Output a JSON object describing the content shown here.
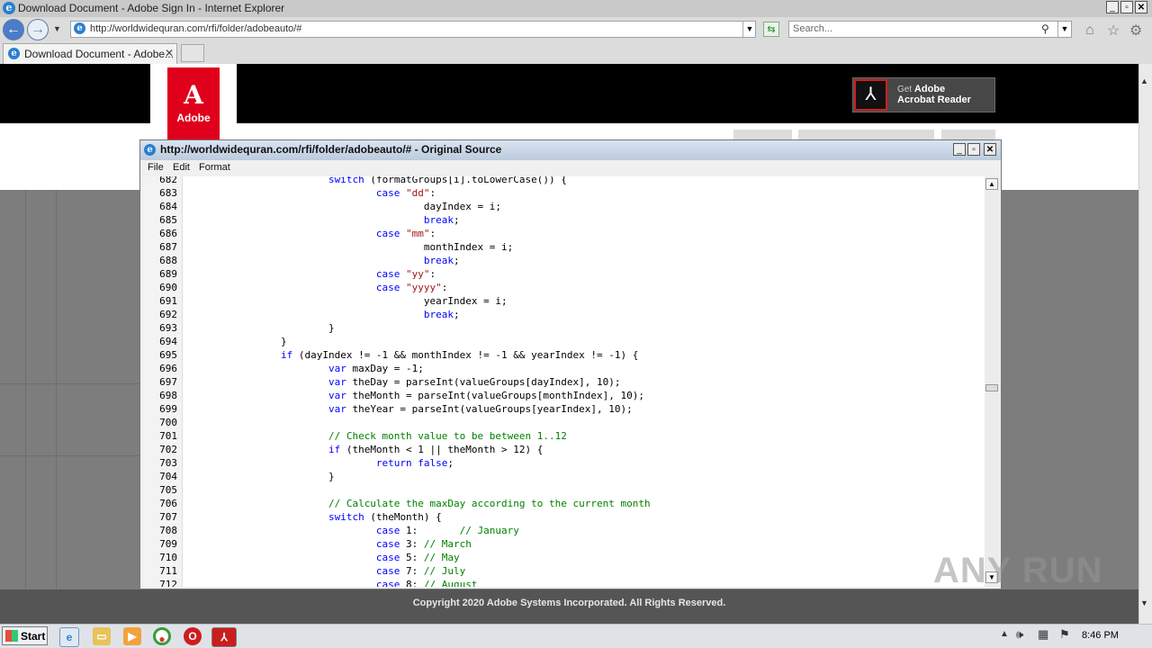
{
  "browser": {
    "window_title": "Download Document - Adobe Sign In - Internet Explorer",
    "url": "http://worldwidequran.com/rfi/folder/adobeauto/#",
    "search_placeholder": "Search...",
    "tab_label": "Download Document - Adobe..."
  },
  "page": {
    "logo_letter": "A",
    "logo_word": "Adobe",
    "reader_get": "Get",
    "reader_adobe": "Adobe",
    "reader_product": "Acrobat Reader",
    "footer": "Copyright 2020 Adobe Systems Incorporated. All Rights Reserved."
  },
  "source_window": {
    "title": "http://worldwidequran.com/rfi/folder/adobeauto/# - Original Source",
    "menu": [
      "File",
      "Edit",
      "Format"
    ],
    "lines": [
      {
        "n": "682",
        "segs": [
          {
            "t": "                        "
          },
          {
            "t": "switch",
            "c": "kw"
          },
          {
            "t": " (formatGroups[i].toLowerCase()) {"
          }
        ]
      },
      {
        "n": "683",
        "segs": [
          {
            "t": "                                "
          },
          {
            "t": "case",
            "c": "kw"
          },
          {
            "t": " "
          },
          {
            "t": "\"dd\"",
            "c": "str"
          },
          {
            "t": ":"
          }
        ]
      },
      {
        "n": "684",
        "segs": [
          {
            "t": "                                        dayIndex = i;"
          }
        ]
      },
      {
        "n": "685",
        "segs": [
          {
            "t": "                                        "
          },
          {
            "t": "break",
            "c": "kw"
          },
          {
            "t": ";"
          }
        ]
      },
      {
        "n": "686",
        "segs": [
          {
            "t": "                                "
          },
          {
            "t": "case",
            "c": "kw"
          },
          {
            "t": " "
          },
          {
            "t": "\"mm\"",
            "c": "str"
          },
          {
            "t": ":"
          }
        ]
      },
      {
        "n": "687",
        "segs": [
          {
            "t": "                                        monthIndex = i;"
          }
        ]
      },
      {
        "n": "688",
        "segs": [
          {
            "t": "                                        "
          },
          {
            "t": "break",
            "c": "kw"
          },
          {
            "t": ";"
          }
        ]
      },
      {
        "n": "689",
        "segs": [
          {
            "t": "                                "
          },
          {
            "t": "case",
            "c": "kw"
          },
          {
            "t": " "
          },
          {
            "t": "\"yy\"",
            "c": "str"
          },
          {
            "t": ":"
          }
        ]
      },
      {
        "n": "690",
        "segs": [
          {
            "t": "                                "
          },
          {
            "t": "case",
            "c": "kw"
          },
          {
            "t": " "
          },
          {
            "t": "\"yyyy\"",
            "c": "str"
          },
          {
            "t": ":"
          }
        ]
      },
      {
        "n": "691",
        "segs": [
          {
            "t": "                                        yearIndex = i;"
          }
        ]
      },
      {
        "n": "692",
        "segs": [
          {
            "t": "                                        "
          },
          {
            "t": "break",
            "c": "kw"
          },
          {
            "t": ";"
          }
        ]
      },
      {
        "n": "693",
        "segs": [
          {
            "t": "                        }"
          }
        ]
      },
      {
        "n": "694",
        "segs": [
          {
            "t": "                }"
          }
        ]
      },
      {
        "n": "695",
        "segs": [
          {
            "t": "                "
          },
          {
            "t": "if",
            "c": "kw"
          },
          {
            "t": " (dayIndex != -1 && monthIndex != -1 && yearIndex != -1) {"
          }
        ]
      },
      {
        "n": "696",
        "segs": [
          {
            "t": "                        "
          },
          {
            "t": "var",
            "c": "kw"
          },
          {
            "t": " maxDay = -1;"
          }
        ]
      },
      {
        "n": "697",
        "segs": [
          {
            "t": "                        "
          },
          {
            "t": "var",
            "c": "kw"
          },
          {
            "t": " theDay = parseInt(valueGroups[dayIndex], 10);"
          }
        ]
      },
      {
        "n": "698",
        "segs": [
          {
            "t": "                        "
          },
          {
            "t": "var",
            "c": "kw"
          },
          {
            "t": " theMonth = parseInt(valueGroups[monthIndex], 10);"
          }
        ]
      },
      {
        "n": "699",
        "segs": [
          {
            "t": "                        "
          },
          {
            "t": "var",
            "c": "kw"
          },
          {
            "t": " theYear = parseInt(valueGroups[yearIndex], 10);"
          }
        ]
      },
      {
        "n": "700",
        "segs": [
          {
            "t": ""
          }
        ]
      },
      {
        "n": "701",
        "segs": [
          {
            "t": "                        "
          },
          {
            "t": "// Check month value to be between 1..12",
            "c": "cmt"
          }
        ]
      },
      {
        "n": "702",
        "segs": [
          {
            "t": "                        "
          },
          {
            "t": "if",
            "c": "kw"
          },
          {
            "t": " (theMonth < 1 || theMonth > 12) {"
          }
        ]
      },
      {
        "n": "703",
        "segs": [
          {
            "t": "                                "
          },
          {
            "t": "return",
            "c": "kw"
          },
          {
            "t": " "
          },
          {
            "t": "false",
            "c": "kw"
          },
          {
            "t": ";"
          }
        ]
      },
      {
        "n": "704",
        "segs": [
          {
            "t": "                        }"
          }
        ]
      },
      {
        "n": "705",
        "segs": [
          {
            "t": ""
          }
        ]
      },
      {
        "n": "706",
        "segs": [
          {
            "t": "                        "
          },
          {
            "t": "// Calculate the maxDay according to the current month",
            "c": "cmt"
          }
        ]
      },
      {
        "n": "707",
        "segs": [
          {
            "t": "                        "
          },
          {
            "t": "switch",
            "c": "kw"
          },
          {
            "t": " (theMonth) {"
          }
        ]
      },
      {
        "n": "708",
        "segs": [
          {
            "t": "                                "
          },
          {
            "t": "case",
            "c": "kw"
          },
          {
            "t": " 1:       "
          },
          {
            "t": "// January",
            "c": "cmt"
          }
        ]
      },
      {
        "n": "709",
        "segs": [
          {
            "t": "                                "
          },
          {
            "t": "case",
            "c": "kw"
          },
          {
            "t": " 3: "
          },
          {
            "t": "// March",
            "c": "cmt"
          }
        ]
      },
      {
        "n": "710",
        "segs": [
          {
            "t": "                                "
          },
          {
            "t": "case",
            "c": "kw"
          },
          {
            "t": " 5: "
          },
          {
            "t": "// May",
            "c": "cmt"
          }
        ]
      },
      {
        "n": "711",
        "segs": [
          {
            "t": "                                "
          },
          {
            "t": "case",
            "c": "kw"
          },
          {
            "t": " 7: "
          },
          {
            "t": "// July",
            "c": "cmt"
          }
        ]
      },
      {
        "n": "712",
        "segs": [
          {
            "t": "                                "
          },
          {
            "t": "case",
            "c": "kw"
          },
          {
            "t": " 8: "
          },
          {
            "t": "// August",
            "c": "cmt"
          }
        ]
      }
    ]
  },
  "taskbar": {
    "start_label": "Start",
    "clock": "8:46 PM"
  },
  "watermark": "ANY RUN"
}
